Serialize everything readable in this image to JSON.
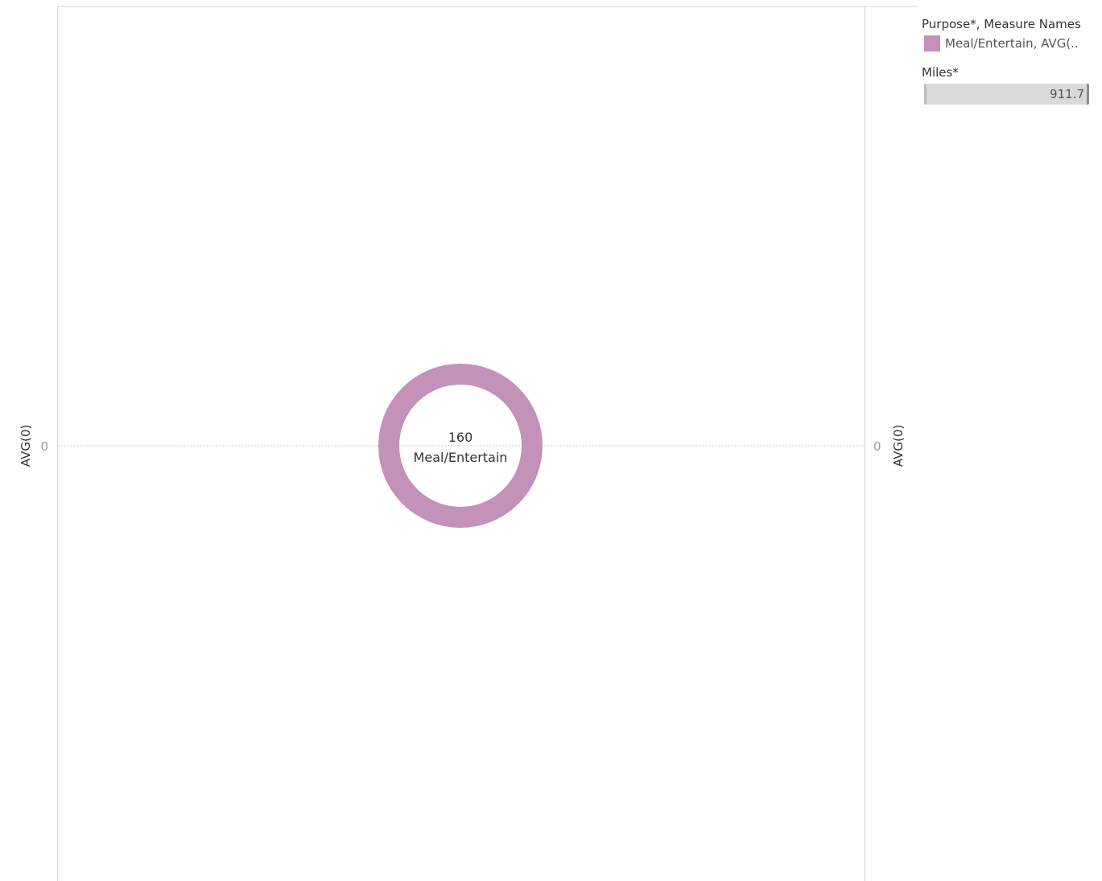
{
  "chart_data": {
    "type": "pie",
    "title": "",
    "ylabel_left": "AVG(0)",
    "ylabel_right": "AVG(0)",
    "y_ticks": [
      0
    ],
    "marks": [
      {
        "label": "Meal/Entertain",
        "value": 160,
        "x": 0,
        "y": 0,
        "shape": "donut",
        "color": "#c491b8"
      }
    ],
    "legend": {
      "placement": "top-right",
      "color_title": "Purpose*, Measure Names",
      "color_entries": [
        {
          "label": "Meal/Entertain, AVG(..",
          "color": "#c491b8"
        }
      ],
      "size_title": "Miles*",
      "size_value": "911.7"
    }
  },
  "colors": {
    "mark": "#c491b8",
    "axis_line": "#d6d6d6",
    "zero_line": "#c8c8c8",
    "tick_text": "#999999",
    "axis_label_text": "#333333"
  }
}
